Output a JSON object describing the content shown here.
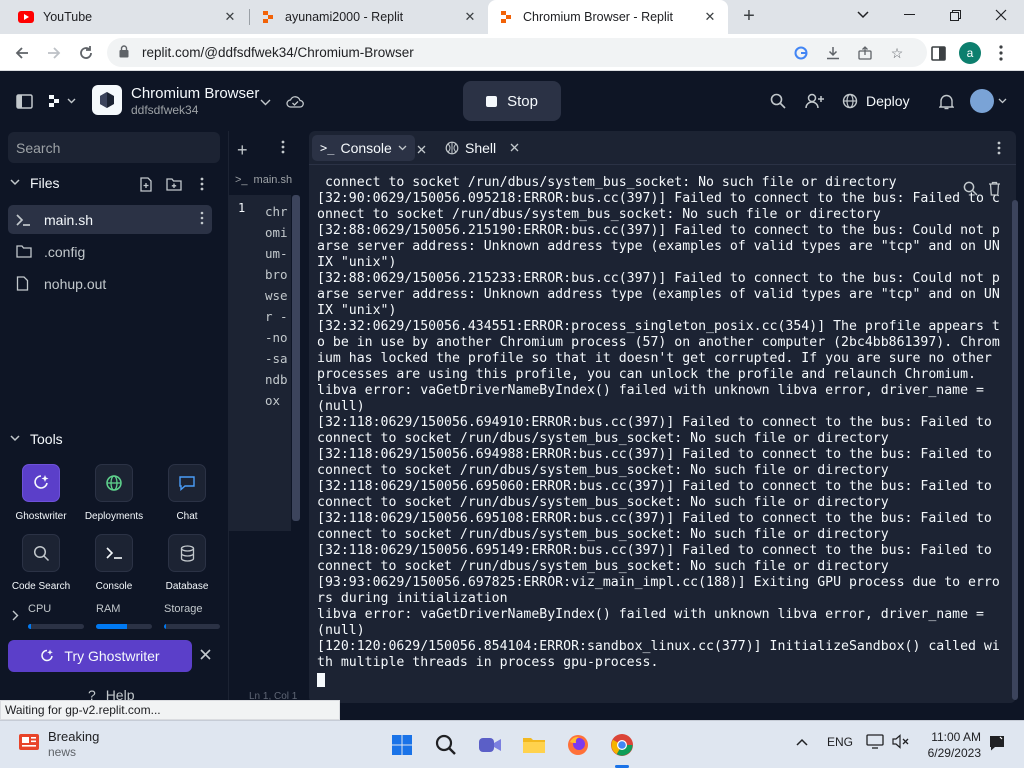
{
  "browser": {
    "tabs": [
      {
        "title": "YouTube",
        "favicon": "youtube-icon"
      },
      {
        "title": "ayunami2000 - Replit",
        "favicon": "replit-icon"
      },
      {
        "title": "Chromium Browser - Replit",
        "favicon": "replit-icon"
      }
    ],
    "url": "replit.com/@ddfsdfwek34/Chromium-Browser",
    "profile_initial": "a",
    "status_text": "Waiting for gp-v2.replit.com..."
  },
  "header": {
    "repl_name": "Chromium Browser",
    "repl_owner": "ddfsdfwek34",
    "stop_label": "Stop",
    "deploy_label": "Deploy"
  },
  "sidebar": {
    "search_placeholder": "Search",
    "files_label": "Files",
    "files": [
      {
        "name": "main.sh",
        "selected": true
      },
      {
        "name": ".config",
        "selected": false
      },
      {
        "name": "nohup.out",
        "selected": false
      }
    ],
    "tools_label": "Tools",
    "tools": [
      {
        "label": "Ghostwriter",
        "icon": "ghostwriter-icon"
      },
      {
        "label": "Deployments",
        "icon": "deployments-icon"
      },
      {
        "label": "Chat",
        "icon": "chat-icon"
      },
      {
        "label": "Code Search",
        "icon": "search-icon"
      },
      {
        "label": "Console",
        "icon": "console-icon"
      },
      {
        "label": "Database",
        "icon": "database-icon"
      }
    ],
    "resources": [
      {
        "label": "CPU",
        "usage": 0.05
      },
      {
        "label": "RAM",
        "usage": 0.55
      },
      {
        "label": "Storage",
        "usage": 0.03
      }
    ],
    "ghostwriter_cta": "Try Ghostwriter",
    "help_label": "Help"
  },
  "editor": {
    "tab_label": "main.sh",
    "line_number": "1",
    "code": "chromium-browser --no-sandbox",
    "status": "Ln 1, Col 1"
  },
  "console": {
    "tabs": [
      {
        "label": "Console",
        "active": true
      },
      {
        "label": "Shell",
        "active": false
      }
    ],
    "output": " connect to socket /run/dbus/system_bus_socket: No such file or directory\n[32:90:0629/150056.095218:ERROR:bus.cc(397)] Failed to connect to the bus: Failed to connect to socket /run/dbus/system_bus_socket: No such file or directory\n[32:88:0629/150056.215190:ERROR:bus.cc(397)] Failed to connect to the bus: Could not parse server address: Unknown address type (examples of valid types are \"tcp\" and on UNIX \"unix\")\n[32:88:0629/150056.215233:ERROR:bus.cc(397)] Failed to connect to the bus: Could not parse server address: Unknown address type (examples of valid types are \"tcp\" and on UNIX \"unix\")\n[32:32:0629/150056.434551:ERROR:process_singleton_posix.cc(354)] The profile appears to be in use by another Chromium process (57) on another computer (2bc4bb861397). Chromium has locked the profile so that it doesn't get corrupted. If you are sure no other processes are using this profile, you can unlock the profile and relaunch Chromium.\nlibva error: vaGetDriverNameByIndex() failed with unknown libva error, driver_name = (null)\n[32:118:0629/150056.694910:ERROR:bus.cc(397)] Failed to connect to the bus: Failed to connect to socket /run/dbus/system_bus_socket: No such file or directory\n[32:118:0629/150056.694988:ERROR:bus.cc(397)] Failed to connect to the bus: Failed to connect to socket /run/dbus/system_bus_socket: No such file or directory\n[32:118:0629/150056.695060:ERROR:bus.cc(397)] Failed to connect to the bus: Failed to connect to socket /run/dbus/system_bus_socket: No such file or directory\n[32:118:0629/150056.695108:ERROR:bus.cc(397)] Failed to connect to the bus: Failed to connect to socket /run/dbus/system_bus_socket: No such file or directory\n[32:118:0629/150056.695149:ERROR:bus.cc(397)] Failed to connect to the bus: Failed to connect to socket /run/dbus/system_bus_socket: No such file or directory\n[93:93:0629/150056.697825:ERROR:viz_main_impl.cc(188)] Exiting GPU process due to errors during initialization\nlibva error: vaGetDriverNameByIndex() failed with unknown libva error, driver_name = (null)\n[120:120:0629/150056.854104:ERROR:sandbox_linux.cc(377)] InitializeSandbox() called with multiple threads in process gpu-process."
  },
  "taskbar": {
    "news_title": "Breaking",
    "news_sub": "news",
    "language": "ENG",
    "time": "11:00 AM",
    "date": "6/29/2023"
  },
  "colors": {
    "replit_bg": "#0e1525",
    "panel_bg": "#1c2333",
    "accent_purple": "#5b3fc9",
    "accent_blue": "#0079f2"
  }
}
